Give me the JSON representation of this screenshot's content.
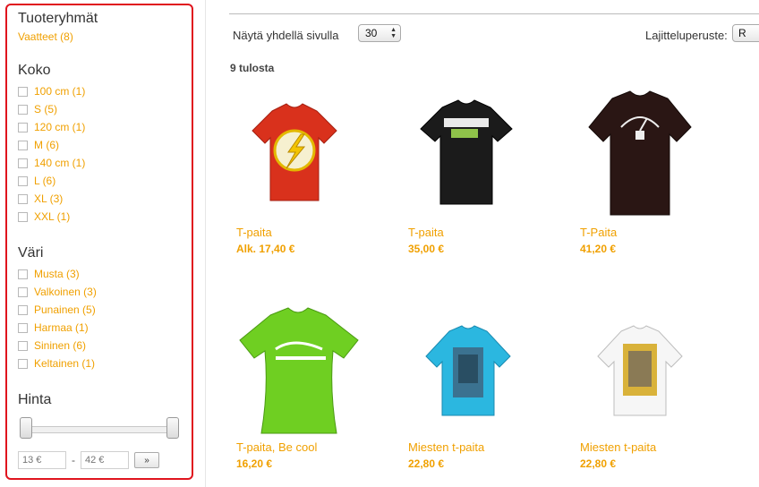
{
  "sidebar": {
    "groups_heading": "Tuoteryhmät",
    "groups_link": "Vaatteet (8)",
    "size_heading": "Koko",
    "sizes": [
      "100 cm (1)",
      "S (5)",
      "120 cm (1)",
      "M (6)",
      "140 cm (1)",
      "L (6)",
      "XL (3)",
      "XXL (1)"
    ],
    "color_heading": "Väri",
    "colors": [
      "Musta (3)",
      "Valkoinen (3)",
      "Punainen (5)",
      "Harmaa (1)",
      "Sininen (6)",
      "Keltainen (1)"
    ],
    "price_heading": "Hinta",
    "price_min_placeholder": "13 €",
    "price_max_placeholder": "42 €",
    "price_go": "»"
  },
  "toolbar": {
    "per_page_label": "Näytä yhdellä sivulla",
    "per_page_value": "30",
    "sort_label": "Lajitteluperuste:",
    "sort_value": "R"
  },
  "results_text": "9 tulosta",
  "products": [
    {
      "name": "T-paita",
      "price": "Alk. 17,40 €",
      "image": "flash-red-tshirt"
    },
    {
      "name": "T-paita",
      "price": "35,00 €",
      "image": "call-of-duty-black-tshirt"
    },
    {
      "name": "T-Paita",
      "price": "41,20 €",
      "image": "war-peace-gauge-black-tshirt"
    },
    {
      "name": "T-paita, Be cool",
      "price": "16,20 €",
      "image": "green-womens-tshirt"
    },
    {
      "name": "Miesten t-paita",
      "price": "22,80 €",
      "image": "blue-print-tshirt"
    },
    {
      "name": "Miesten t-paita",
      "price": "22,80 €",
      "image": "white-print-tshirt"
    }
  ],
  "colors": {
    "accent": "#f0a000",
    "frame": "#e0141e"
  }
}
